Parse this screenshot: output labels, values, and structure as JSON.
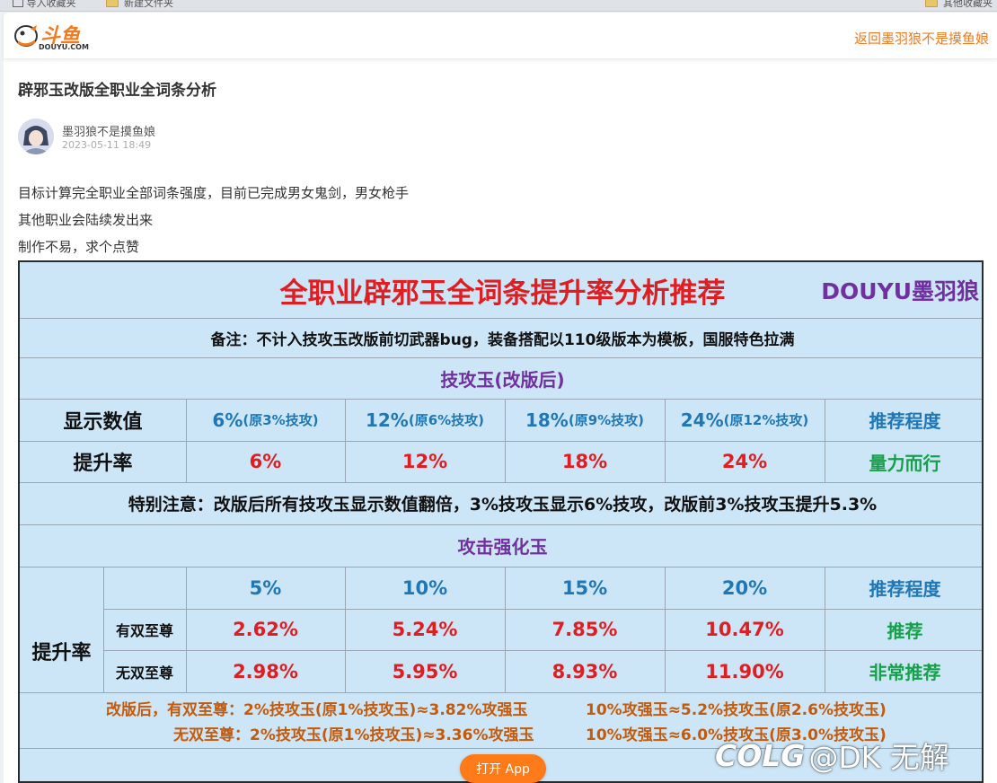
{
  "browser": {
    "bookmark_left": "导入收藏夹",
    "bookmark_mid": "新建文件夹",
    "bookmark_right": "其他收藏夹"
  },
  "header": {
    "logo_text": "斗鱼",
    "logo_sub": "DOUYU.COM",
    "back_link": "返回墨羽狼不是摸鱼娘"
  },
  "post": {
    "title": "辟邪玉改版全职业全词条分析",
    "author": "墨羽狼不是摸鱼娘",
    "date": "2023-05-11 18:49",
    "paragraphs": [
      "目标计算完全职业全部词条强度，目前已完成男女鬼剑，男女枪手",
      "其他职业会陆续发出来",
      "制作不易，求个点赞"
    ]
  },
  "table": {
    "title": "全职业辟邪玉全词条提升率分析推荐",
    "brand": "DOUYU墨羽狼",
    "remark": "备注：不计入技攻玉改版前切武器bug，装备搭配以110级版本为模板，国服特色拉满",
    "skill": {
      "heading": "技攻玉(改版后)",
      "row1_label": "显示数值",
      "values": [
        "6%",
        "12%",
        "18%",
        "24%"
      ],
      "originals": [
        "(原3%技攻)",
        "(原6%技攻)",
        "(原9%技攻)",
        "(原12%技攻)"
      ],
      "rec_label": "推荐程度",
      "row2_label": "提升率",
      "rates": [
        "6%",
        "12%",
        "18%",
        "24%"
      ],
      "rec_value": "量力而行"
    },
    "special_note": "特别注意：改版后所有技攻玉显示数值翻倍，3%技攻玉显示6%技攻，改版前3%技攻玉提升5.3%",
    "attack": {
      "heading": "攻击强化玉",
      "values": [
        "5%",
        "10%",
        "15%",
        "20%"
      ],
      "rec_label": "推荐程度",
      "group_label": "提升率",
      "rows": [
        {
          "label": "有双至尊",
          "rates": [
            "2.62%",
            "5.24%",
            "7.85%",
            "10.47%"
          ],
          "rec": "推荐"
        },
        {
          "label": "无双至尊",
          "rates": [
            "2.98%",
            "5.95%",
            "8.93%",
            "11.90%"
          ],
          "rec": "非常推荐"
        }
      ]
    },
    "notes": {
      "line1_left": "改版后，有双至尊：2%技攻玉(原1%技攻玉)≈3.82%攻强玉",
      "line1_right": "10%攻强玉≈5.2%技攻玉(原2.6%技攻玉)",
      "line2_left": "无双至尊：2%技攻玉(原1%技攻玉)≈3.36%攻强玉",
      "line2_right": "10%攻强玉≈6.0%技攻玉(原3.0%技攻玉)"
    }
  },
  "open_app": "打开 App",
  "watermark": {
    "logo": "COLG",
    "text": "@DK 无解"
  },
  "colors": {
    "accent": "#f07c22",
    "table_bg": "#cde6f7",
    "red": "#e01e22",
    "blue": "#1f77b5",
    "purple": "#7030a0",
    "green": "#16a04a",
    "orange": "#c45a0b"
  }
}
